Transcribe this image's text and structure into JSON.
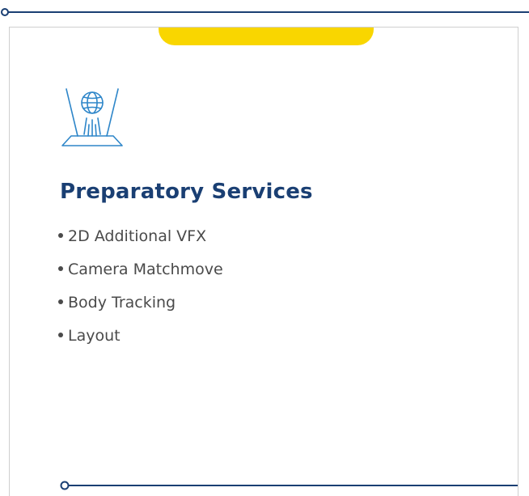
{
  "service": {
    "title": "Preparatory Services",
    "icon": "globe-hologram-icon",
    "items": [
      {
        "label": "2D Additional VFX"
      },
      {
        "label": "Camera Matchmove"
      },
      {
        "label": "Body Tracking"
      },
      {
        "label": "Layout"
      }
    ]
  },
  "colors": {
    "title": "#1a3f73",
    "line": "#1a3f73",
    "accent": "#f9d600",
    "icon": "#2e86c9",
    "text": "#4a4a4a",
    "border": "#cfcfcf"
  }
}
